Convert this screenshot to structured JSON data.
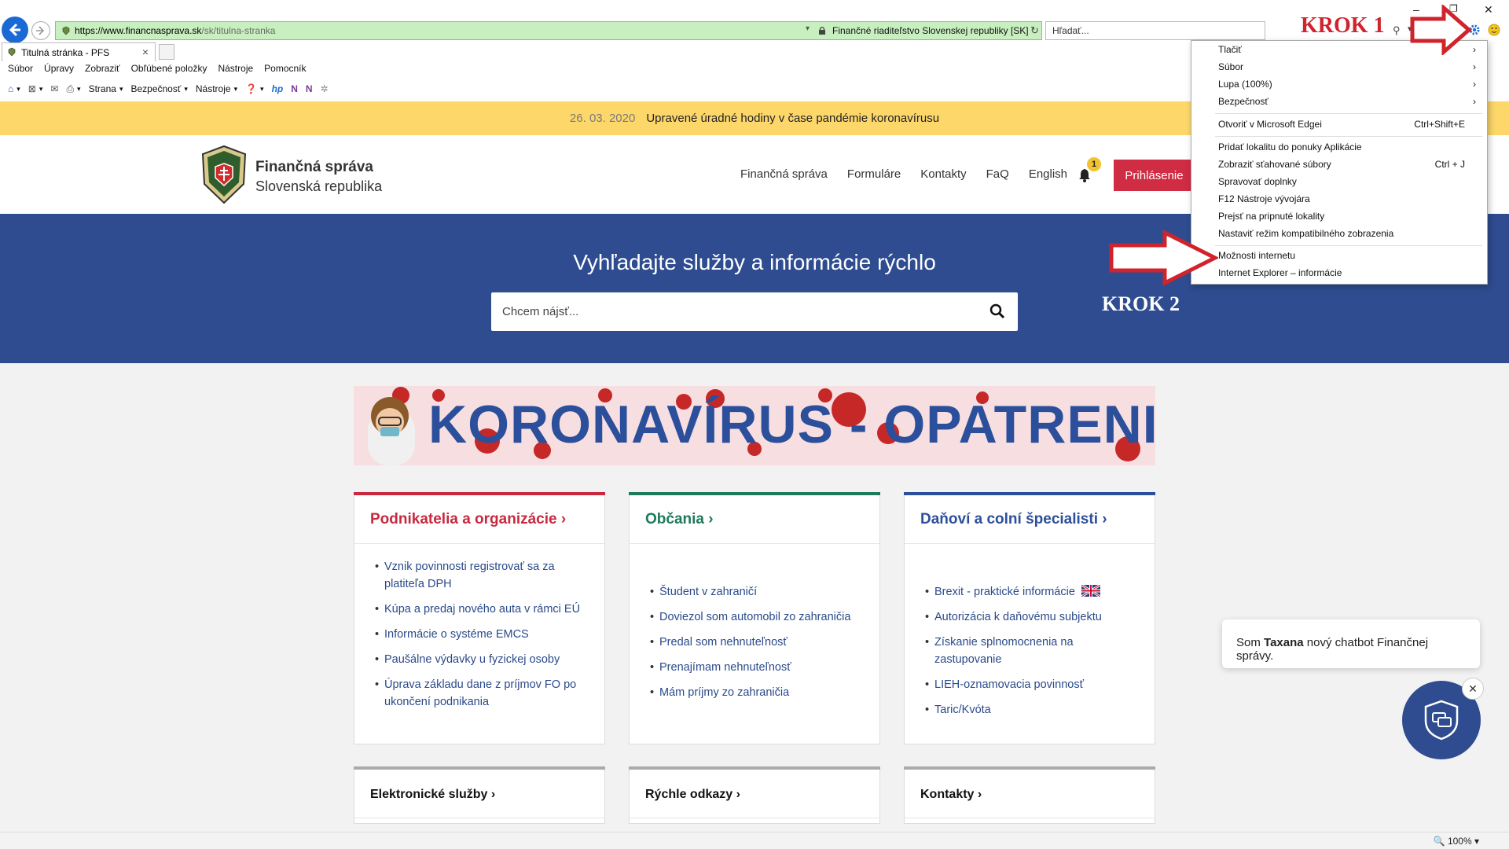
{
  "browser": {
    "url_host": "https://www.financnasprava.sk",
    "url_path": "/sk/titulna-stranka",
    "cert_label": "Finančné riaditeľstvo Slovenskej republiky [SK]",
    "search_placeholder": "Hľadať...",
    "tab_title": "Titulná stránka - PFS",
    "menubar": [
      "Súbor",
      "Úpravy",
      "Zobraziť",
      "Obľúbené položky",
      "Nástroje",
      "Pomocník"
    ],
    "commandbar": {
      "page": "Strana",
      "safety": "Bezpečnosť",
      "tools": "Nástroje"
    },
    "zoom": "100%"
  },
  "annotations": {
    "step1": "KROK 1",
    "step2": "KROK 2",
    "arrow_color": "#d0232c"
  },
  "tools_menu": {
    "items": [
      {
        "label": "Tlačiť",
        "submenu": true
      },
      {
        "label": "Súbor",
        "submenu": true
      },
      {
        "label": "Lupa (100%)",
        "submenu": true
      },
      {
        "label": "Bezpečnosť",
        "submenu": true
      },
      {
        "label": "Otvoriť v Microsoft Edgei",
        "shortcut": "Ctrl+Shift+E"
      },
      {
        "label": "Pridať lokalitu  do ponuky Aplikácie"
      },
      {
        "label": "Zobraziť sťahované súbory",
        "shortcut": "Ctrl + J"
      },
      {
        "label": "Spravovať doplnky"
      },
      {
        "label": "F12 Nástroje vývojára"
      },
      {
        "label": "Prejsť na pripnuté lokality"
      },
      {
        "label": "Nastaviť režim kompatibilného zobrazenia"
      },
      {
        "label": "Možnosti internetu"
      },
      {
        "label": "Internet Explorer – informácie"
      }
    ]
  },
  "alert": {
    "date": "26. 03. 2020",
    "text": "Upravené úradné hodiny v čase pandémie koronavírusu"
  },
  "header": {
    "brand_line1": "Finančná správa",
    "brand_line2": "Slovenská republika",
    "nav": [
      "Finančná správa",
      "Formuláre",
      "Kontakty",
      "FaQ",
      "English"
    ],
    "notifications_count": "1",
    "login_label": "Prihlásenie"
  },
  "hero": {
    "title": "Vyhľadajte služby a informácie rýchlo",
    "search_placeholder": "Chcem nájsť..."
  },
  "banner": {
    "text": "KORONAVÍRUS - OPATRENIA"
  },
  "cards": [
    {
      "title": "Podnikatelia a organizácie",
      "color": "#c8293f",
      "items": [
        "Vznik povinnosti registrovať sa za platiteľa DPH",
        "Kúpa a predaj nového auta v rámci EÚ",
        "Informácie o systéme EMCS",
        "Paušálne výdavky u fyzickej osoby",
        "Úprava základu dane z príjmov FO po ukončení podnikania"
      ]
    },
    {
      "title": "Občania",
      "color": "#1e7a5a",
      "items": [
        "Študent v zahraničí",
        "Doviezol som automobil zo zahraničia",
        "Predal som nehnuteľnosť",
        "Prenajímam nehnuteľnosť",
        "Mám príjmy zo zahraničia"
      ]
    },
    {
      "title": "Daňoví a colní špecialisti",
      "color": "#2c4f9b",
      "items": [
        "Brexit - praktické informácie",
        "Autorizácia k daňovému subjektu",
        "Získanie splnomocnenia na zastupovanie",
        "LIEH-oznamovacia povinnosť",
        "Taric/Kvóta"
      ]
    }
  ],
  "lower_cards": [
    "Elektronické služby",
    "Rýchle odkazy",
    "Kontakty"
  ],
  "chat": {
    "prefix": "Som ",
    "name": "Taxana",
    "suffix": " nový chatbot Finančnej správy."
  }
}
